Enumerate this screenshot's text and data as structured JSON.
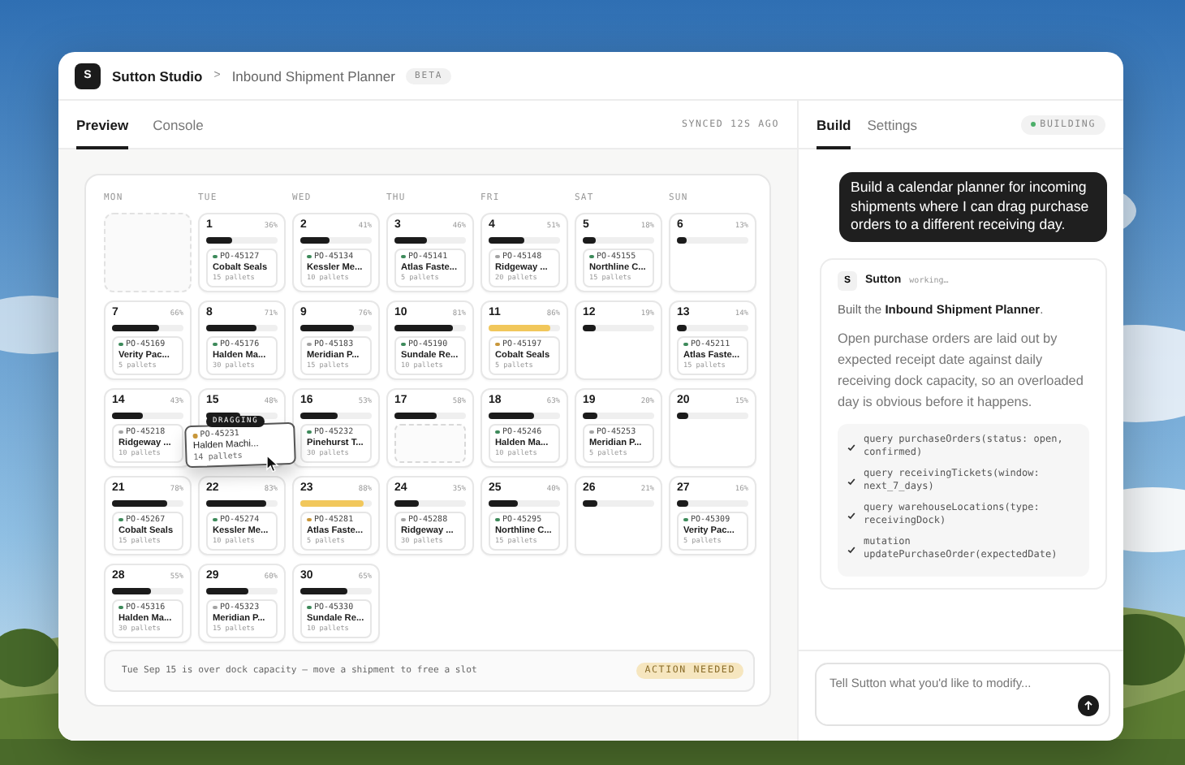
{
  "app": {
    "logo": "S",
    "workspace": "Sutton Studio",
    "separator": ">",
    "page": "Inbound Shipment Planner",
    "badge": "BETA"
  },
  "left_tabs": [
    {
      "label": "Preview",
      "selected": true
    },
    {
      "label": "Console",
      "selected": false
    }
  ],
  "sync_status": "SYNCED 12S AGO",
  "calendar": {
    "weekdays": [
      "MON",
      "TUE",
      "WED",
      "THU",
      "FRI",
      "SAT",
      "SUN"
    ],
    "days": [
      {
        "kind": "empty"
      },
      {
        "kind": "day",
        "date": "1",
        "load": "36%",
        "level": 0.36,
        "over_capacity": false,
        "drop_target": false,
        "shipment": {
          "po": "PO-45127",
          "supplier": "Cobalt Seals",
          "pallets": "15 pallets",
          "color": "#3d8a5a"
        }
      },
      {
        "kind": "day",
        "date": "2",
        "load": "41%",
        "level": 0.41,
        "over_capacity": false,
        "drop_target": false,
        "shipment": {
          "po": "PO-45134",
          "supplier": "Kessler Me...",
          "pallets": "10 pallets",
          "color": "#3d8a5a"
        }
      },
      {
        "kind": "day",
        "date": "3",
        "load": "46%",
        "level": 0.46,
        "over_capacity": false,
        "drop_target": false,
        "shipment": {
          "po": "PO-45141",
          "supplier": "Atlas Faste...",
          "pallets": "5 pallets",
          "color": "#3d8a5a"
        }
      },
      {
        "kind": "day",
        "date": "4",
        "load": "51%",
        "level": 0.51,
        "over_capacity": false,
        "drop_target": false,
        "shipment": {
          "po": "PO-45148",
          "supplier": "Ridgeway ...",
          "pallets": "20 pallets",
          "color": "#a3a3a3"
        }
      },
      {
        "kind": "day",
        "date": "5",
        "load": "18%",
        "level": 0.18,
        "over_capacity": false,
        "drop_target": false,
        "shipment": {
          "po": "PO-45155",
          "supplier": "Northline C...",
          "pallets": "15 pallets",
          "color": "#3d8a5a"
        }
      },
      {
        "kind": "day",
        "date": "6",
        "load": "13%",
        "level": 0.13,
        "over_capacity": false,
        "drop_target": false
      },
      {
        "kind": "day",
        "date": "7",
        "load": "66%",
        "level": 0.66,
        "over_capacity": false,
        "drop_target": false,
        "shipment": {
          "po": "PO-45169",
          "supplier": "Verity Pac...",
          "pallets": "5 pallets",
          "color": "#3d8a5a"
        }
      },
      {
        "kind": "day",
        "date": "8",
        "load": "71%",
        "level": 0.71,
        "over_capacity": false,
        "drop_target": false,
        "shipment": {
          "po": "PO-45176",
          "supplier": "Halden Ma...",
          "pallets": "30 pallets",
          "color": "#3d8a5a"
        }
      },
      {
        "kind": "day",
        "date": "9",
        "load": "76%",
        "level": 0.76,
        "over_capacity": false,
        "drop_target": false,
        "shipment": {
          "po": "PO-45183",
          "supplier": "Meridian P...",
          "pallets": "15 pallets",
          "color": "#a3a3a3"
        }
      },
      {
        "kind": "day",
        "date": "10",
        "load": "81%",
        "level": 0.81,
        "over_capacity": false,
        "drop_target": false,
        "shipment": {
          "po": "PO-45190",
          "supplier": "Sundale Re...",
          "pallets": "10 pallets",
          "color": "#3d8a5a"
        }
      },
      {
        "kind": "day",
        "date": "11",
        "load": "86%",
        "level": 0.86,
        "over_capacity": true,
        "drop_target": false,
        "shipment": {
          "po": "PO-45197",
          "supplier": "Cobalt Seals",
          "pallets": "5 pallets",
          "color": "#c8973a"
        }
      },
      {
        "kind": "day",
        "date": "12",
        "load": "19%",
        "level": 0.19,
        "over_capacity": false,
        "drop_target": false
      },
      {
        "kind": "day",
        "date": "13",
        "load": "14%",
        "level": 0.14,
        "over_capacity": false,
        "drop_target": false,
        "shipment": {
          "po": "PO-45211",
          "supplier": "Atlas Faste...",
          "pallets": "15 pallets",
          "color": "#3d8a5a"
        }
      },
      {
        "kind": "day",
        "date": "14",
        "load": "43%",
        "level": 0.43,
        "over_capacity": false,
        "drop_target": false,
        "shipment": {
          "po": "PO-45218",
          "supplier": "Ridgeway ...",
          "pallets": "10 pallets",
          "color": "#a3a3a3"
        }
      },
      {
        "kind": "day",
        "date": "15",
        "load": "48%",
        "level": 0.48,
        "over_capacity": false,
        "drop_target": false
      },
      {
        "kind": "day",
        "date": "16",
        "load": "53%",
        "level": 0.53,
        "over_capacity": false,
        "drop_target": false,
        "shipment": {
          "po": "PO-45232",
          "supplier": "Pinehurst T...",
          "pallets": "30 pallets",
          "color": "#3d8a5a"
        }
      },
      {
        "kind": "day",
        "date": "17",
        "load": "58%",
        "level": 0.58,
        "over_capacity": false,
        "drop_target": true
      },
      {
        "kind": "day",
        "date": "18",
        "load": "63%",
        "level": 0.63,
        "over_capacity": false,
        "drop_target": false,
        "shipment": {
          "po": "PO-45246",
          "supplier": "Halden Ma...",
          "pallets": "10 pallets",
          "color": "#3d8a5a"
        }
      },
      {
        "kind": "day",
        "date": "19",
        "load": "20%",
        "level": 0.2,
        "over_capacity": false,
        "drop_target": false,
        "shipment": {
          "po": "PO-45253",
          "supplier": "Meridian P...",
          "pallets": "5 pallets",
          "color": "#a3a3a3"
        }
      },
      {
        "kind": "day",
        "date": "20",
        "load": "15%",
        "level": 0.15,
        "over_capacity": false,
        "drop_target": false
      },
      {
        "kind": "day",
        "date": "21",
        "load": "78%",
        "level": 0.78,
        "over_capacity": false,
        "drop_target": false,
        "shipment": {
          "po": "PO-45267",
          "supplier": "Cobalt Seals",
          "pallets": "15 pallets",
          "color": "#3d8a5a"
        }
      },
      {
        "kind": "day",
        "date": "22",
        "load": "83%",
        "level": 0.83,
        "over_capacity": false,
        "drop_target": false,
        "shipment": {
          "po": "PO-45274",
          "supplier": "Kessler Me...",
          "pallets": "10 pallets",
          "color": "#3d8a5a"
        }
      },
      {
        "kind": "day",
        "date": "23",
        "load": "88%",
        "level": 0.88,
        "over_capacity": true,
        "drop_target": false,
        "shipment": {
          "po": "PO-45281",
          "supplier": "Atlas Faste...",
          "pallets": "5 pallets",
          "color": "#c8973a"
        }
      },
      {
        "kind": "day",
        "date": "24",
        "load": "35%",
        "level": 0.35,
        "over_capacity": false,
        "drop_target": false,
        "shipment": {
          "po": "PO-45288",
          "supplier": "Ridgeway ...",
          "pallets": "30 pallets",
          "color": "#a3a3a3"
        }
      },
      {
        "kind": "day",
        "date": "25",
        "load": "40%",
        "level": 0.4,
        "over_capacity": false,
        "drop_target": false,
        "shipment": {
          "po": "PO-45295",
          "supplier": "Northline C...",
          "pallets": "15 pallets",
          "color": "#3d8a5a"
        }
      },
      {
        "kind": "day",
        "date": "26",
        "load": "21%",
        "level": 0.21,
        "over_capacity": false,
        "drop_target": false
      },
      {
        "kind": "day",
        "date": "27",
        "load": "16%",
        "level": 0.16,
        "over_capacity": false,
        "drop_target": false,
        "shipment": {
          "po": "PO-45309",
          "supplier": "Verity Pac...",
          "pallets": "5 pallets",
          "color": "#3d8a5a"
        }
      },
      {
        "kind": "day",
        "date": "28",
        "load": "55%",
        "level": 0.55,
        "over_capacity": false,
        "drop_target": false,
        "shipment": {
          "po": "PO-45316",
          "supplier": "Halden Ma...",
          "pallets": "30 pallets",
          "color": "#3d8a5a"
        }
      },
      {
        "kind": "day",
        "date": "29",
        "load": "60%",
        "level": 0.6,
        "over_capacity": false,
        "drop_target": false,
        "shipment": {
          "po": "PO-45323",
          "supplier": "Meridian P...",
          "pallets": "15 pallets",
          "color": "#a3a3a3"
        }
      },
      {
        "kind": "day",
        "date": "30",
        "load": "65%",
        "level": 0.65,
        "over_capacity": false,
        "drop_target": false,
        "shipment": {
          "po": "PO-45330",
          "supplier": "Sundale Re...",
          "pallets": "10 pallets",
          "color": "#3d8a5a"
        }
      }
    ],
    "drag": {
      "tag": "DRAGGING",
      "po": "PO-45231",
      "supplier": "Halden Machi...",
      "pallets": "14 pallets",
      "color": "#c8973a"
    },
    "alert": {
      "message": "Tue Sep 15 is over dock capacity — move a shipment to free a slot",
      "badge": "ACTION NEEDED"
    }
  },
  "right_tabs": [
    {
      "label": "Build",
      "selected": true
    },
    {
      "label": "Settings",
      "selected": false
    }
  ],
  "build_status": "BUILDING",
  "chat": {
    "user_message": "Build a calendar planner for incoming shipments where I can drag purchase orders to a different receiving day.",
    "assistant": {
      "avatar": "S",
      "name": "Sutton",
      "status": "working…",
      "intro": "Built the **Inbound Shipment Planner**.",
      "body": "Open purchase orders are laid out by expected receipt date against daily receiving dock capacity, so an overloaded day is obvious before it happens.",
      "steps": [
        {
          "text": "query purchaseOrders(status: open, confirmed)",
          "done": true
        },
        {
          "text": "query receivingTickets(window: next_7_days)",
          "done": true
        },
        {
          "text": "query warehouseLocations(type: receivingDock)",
          "done": true
        },
        {
          "text": "mutation updatePurchaseOrder(expectedDate)",
          "done": true
        }
      ]
    }
  },
  "composer": {
    "placeholder": "Tell Sutton what you'd like to modify..."
  }
}
